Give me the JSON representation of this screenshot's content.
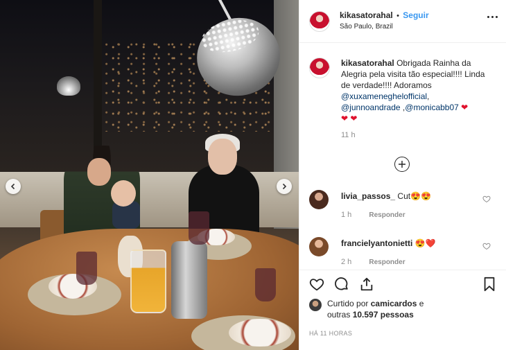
{
  "post": {
    "username": "kikasatorahal",
    "follow_label": "Seguir",
    "separator": "•",
    "location": "São Paulo, Brazil",
    "caption_user": "kikasatorahal",
    "caption_text": "Obrigada Rainha da Alegria pela visita tão especial!!!! Linda de verdade!!!! Adoramos",
    "mention1": "@xuxameneghelofficial",
    "mention2": "@junnoandrade",
    "mention3": "@monicabb07",
    "comma1": ",",
    "comma2": " ,",
    "hearts1": "❤",
    "hearts2": "❤ ❤",
    "time": "11 h"
  },
  "comments": [
    {
      "user": "livia_passos_",
      "text": "Cut😍😍",
      "time": "1 h",
      "reply": "Responder"
    },
    {
      "user": "francielyantonietti",
      "text": "😍❤️",
      "time": "2 h",
      "reply": "Responder"
    }
  ],
  "likes": {
    "prefix": "Curtido por",
    "user": "camicardos",
    "mid": "e",
    "outras": "outras",
    "count": "10.597 pessoas"
  },
  "posted_ago": "HÁ 11 HORAS",
  "colors": {
    "accent": "#3897f0",
    "mention": "#003569",
    "heart": "#e0122d"
  }
}
